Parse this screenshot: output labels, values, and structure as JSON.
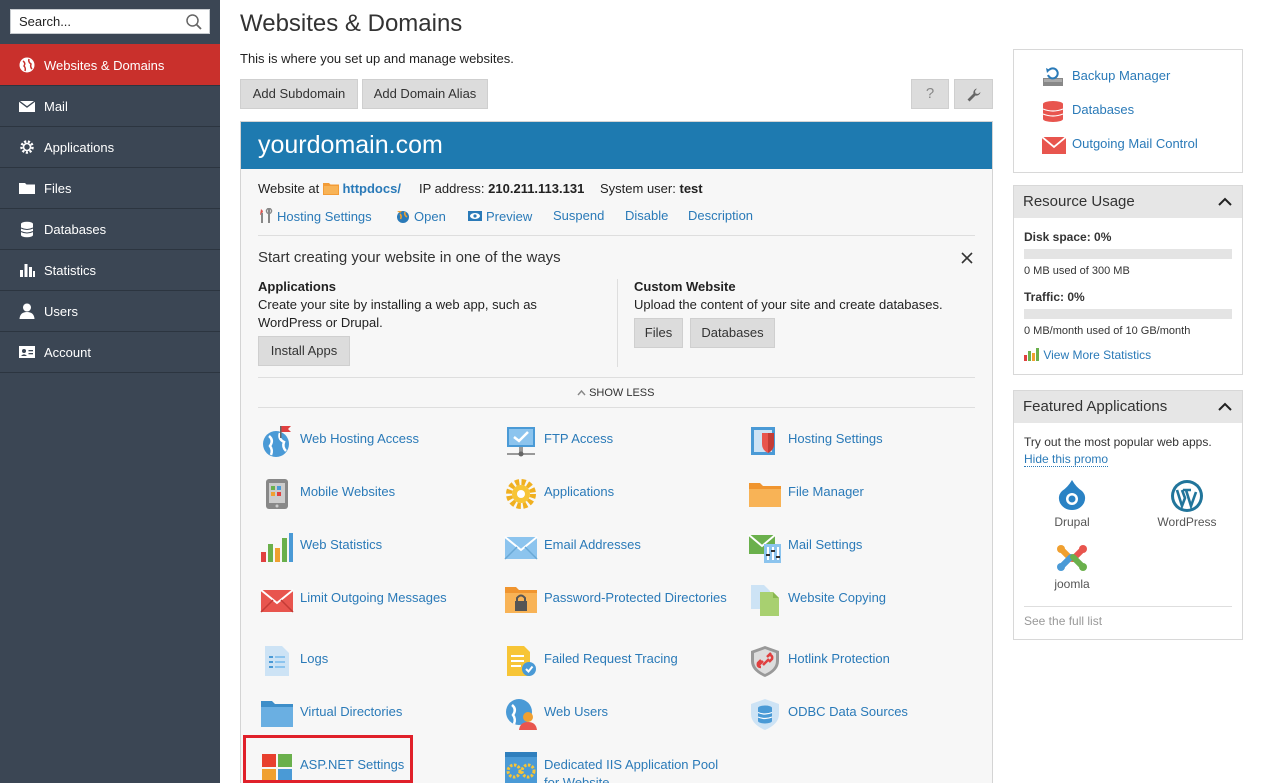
{
  "sidebar": {
    "search_placeholder": "Search...",
    "items": [
      {
        "label": "Websites & Domains"
      },
      {
        "label": "Mail"
      },
      {
        "label": "Applications"
      },
      {
        "label": "Files"
      },
      {
        "label": "Databases"
      },
      {
        "label": "Statistics"
      },
      {
        "label": "Users"
      },
      {
        "label": "Account"
      }
    ]
  },
  "page": {
    "title": "Websites & Domains",
    "subtitle": "This is where you set up and manage websites.",
    "add_subdomain": "Add Subdomain",
    "add_alias": "Add Domain Alias",
    "help_label": "?"
  },
  "domain": {
    "name": "yourdomain.com",
    "website_at_label": "Website at",
    "docroot": "httpdocs/",
    "ip_label": "IP address:",
    "ip": "210.211.113.131",
    "user_label": "System user:",
    "user": "test",
    "actions": [
      "Hosting Settings",
      "Open",
      "Preview",
      "Suspend",
      "Disable",
      "Description"
    ]
  },
  "start": {
    "heading": "Start creating your website in one of the ways",
    "apps_title": "Applications",
    "apps_text1": "Create your site by installing a web app, such as",
    "apps_text2": "WordPress or Drupal.",
    "install_btn": "Install Apps",
    "custom_title": "Custom Website",
    "custom_text": "Upload the content of your site and create databases.",
    "files_btn": "Files",
    "db_btn": "Databases",
    "show_less": "SHOW LESS"
  },
  "tools": [
    {
      "label": "Web Hosting Access",
      "icon": "globe-flag-icon"
    },
    {
      "label": "FTP Access",
      "icon": "ftp-icon"
    },
    {
      "label": "Hosting Settings",
      "icon": "hosting-settings-icon"
    },
    {
      "label": "Mobile Websites",
      "icon": "mobile-icon"
    },
    {
      "label": "Applications",
      "icon": "gear-icon"
    },
    {
      "label": "File Manager",
      "icon": "folder-icon"
    },
    {
      "label": "Web Statistics",
      "icon": "bar-chart-icon"
    },
    {
      "label": "Email Addresses",
      "icon": "envelope-icon"
    },
    {
      "label": "Mail Settings",
      "icon": "mail-settings-icon"
    },
    {
      "label": "Limit Outgoing Messages",
      "icon": "red-envelope-icon"
    },
    {
      "label": "Password-Protected Directories",
      "icon": "locked-folder-icon"
    },
    {
      "label": "Website Copying",
      "icon": "copy-icon"
    },
    {
      "label": "Logs",
      "icon": "log-icon"
    },
    {
      "label": "Failed Request Tracing",
      "icon": "trace-icon"
    },
    {
      "label": "Hotlink Protection",
      "icon": "shield-link-icon"
    },
    {
      "label": "Virtual Directories",
      "icon": "folder-icon"
    },
    {
      "label": "Web Users",
      "icon": "web-users-icon"
    },
    {
      "label": "ODBC Data Sources",
      "icon": "database-icon"
    },
    {
      "label": "ASP.NET Settings",
      "icon": "windows-icon"
    },
    {
      "label": "Dedicated IIS Application Pool for Website",
      "icon": "app-pool-icon"
    }
  ],
  "quick_links": [
    "Backup Manager",
    "Databases",
    "Outgoing Mail Control"
  ],
  "resource": {
    "title": "Resource Usage",
    "disk_label": "Disk space: 0%",
    "disk_fill": 0,
    "disk_used": "0 MB used of 300 MB",
    "traffic_label": "Traffic: 0%",
    "traffic_fill": 0,
    "traffic_used": "0 MB/month used of 10 GB/month",
    "more_stats": "View More Statistics"
  },
  "featured": {
    "title": "Featured Applications",
    "intro": "Try out the most popular web apps.",
    "hide_promo": "Hide this promo",
    "apps": [
      "Drupal",
      "WordPress",
      "joomla"
    ],
    "see_all": "See the full list"
  },
  "colors": {
    "sidebar_bg": "#3b4654",
    "active_nav": "#c9302c",
    "domain_header": "#1e7ab0",
    "link": "#2a7ab8"
  }
}
